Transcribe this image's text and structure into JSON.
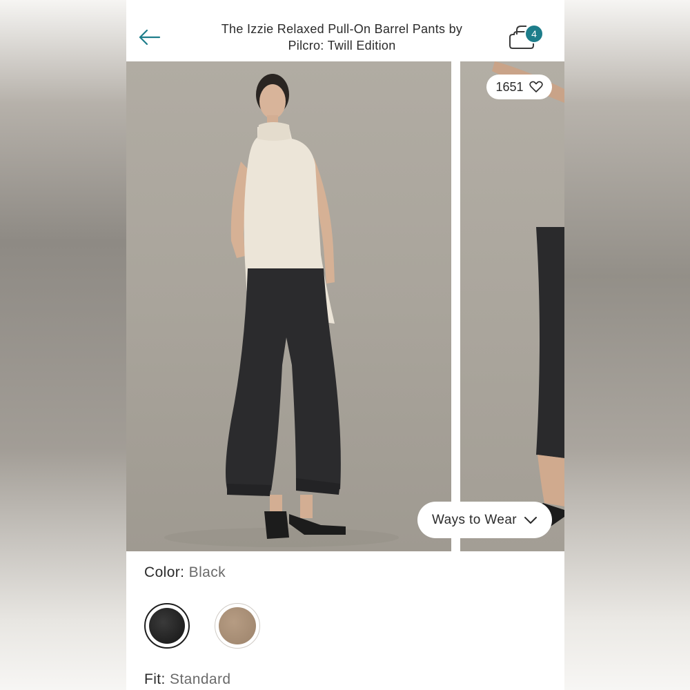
{
  "header": {
    "title": "The Izzie Relaxed Pull-On Barrel Pants by Pilcro: Twill Edition",
    "bag_count": "4"
  },
  "gallery": {
    "like_count": "1651",
    "ways_to_wear_label": "Ways to Wear"
  },
  "color": {
    "label": "Color:",
    "value": "Black",
    "swatches": [
      {
        "name": "Black",
        "hex": "#1c1c1c",
        "selected": true
      },
      {
        "name": "Tan",
        "hex": "#a88e75",
        "selected": false
      }
    ]
  },
  "fit": {
    "label": "Fit:",
    "value": "Standard"
  },
  "colors": {
    "accent": "#1d7d8a",
    "text": "#2a2a2a"
  }
}
